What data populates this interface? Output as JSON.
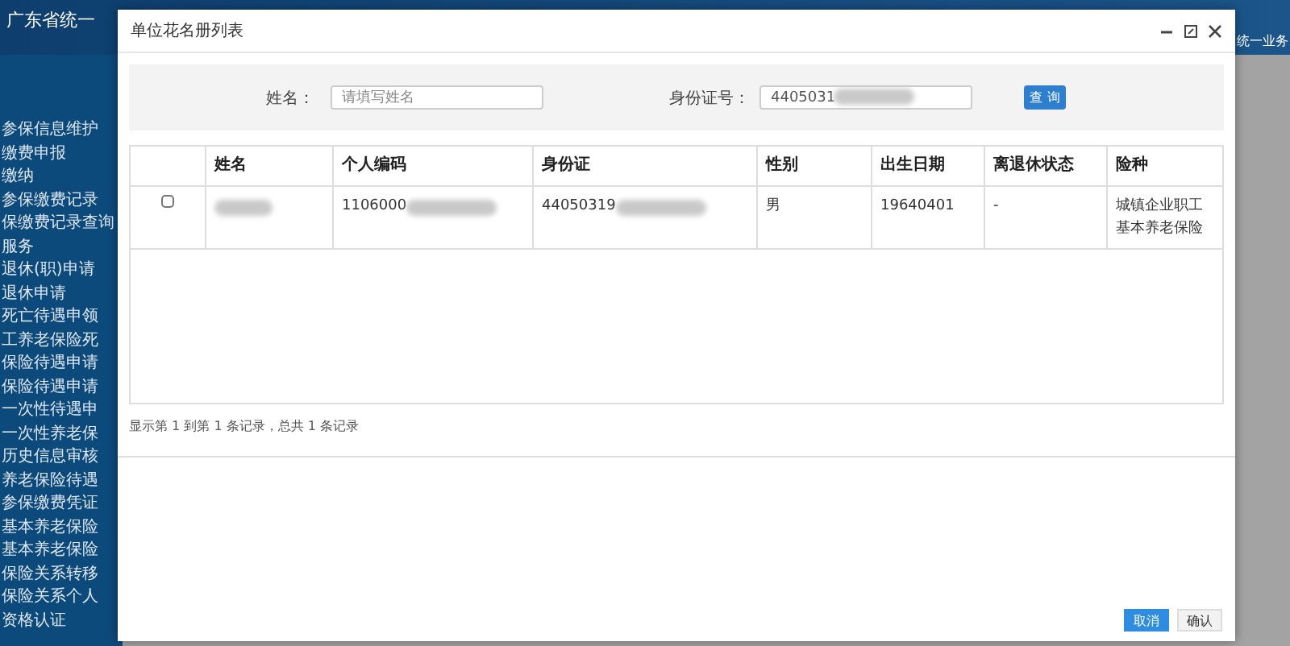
{
  "header": {
    "title": "广东省统一",
    "right_title": "统一业务"
  },
  "sidebar": {
    "items": [
      "参保信息维护",
      "缴费申报",
      "缴纳",
      "参保缴费记录",
      "保缴费记录查询",
      "服务",
      "退休(职)申请",
      "退休申请",
      "死亡待遇申领",
      "工养老保险死",
      "保险待遇申请",
      "保险待遇申请",
      "一次性待遇申",
      "一次性养老保",
      "历史信息审核",
      "养老保险待遇",
      "参保缴费凭证",
      "基本养老保险",
      "基本养老保险",
      "保险关系转移",
      "保险关系个人",
      "资格认证"
    ]
  },
  "dialog": {
    "title": "单位花名册列表",
    "search": {
      "name_label": "姓名：",
      "name_placeholder": "请填写姓名",
      "id_label": "身份证号：",
      "id_value": "4405031",
      "search_button": "查 询"
    },
    "table": {
      "columns": [
        "姓名",
        "个人编码",
        "身份证",
        "性别",
        "出生日期",
        "离退休状态",
        "险种"
      ],
      "rows": [
        {
          "checked": false,
          "cells": [
            "",
            "1106000",
            "44050319",
            "男",
            "19640401",
            "-",
            "城镇企业职工基本养老保险"
          ]
        }
      ]
    },
    "pagination": "显示第 1 到第 1 条记录，总共 1 条记录",
    "buttons": {
      "cancel": "取消",
      "confirm": "确认"
    }
  }
}
